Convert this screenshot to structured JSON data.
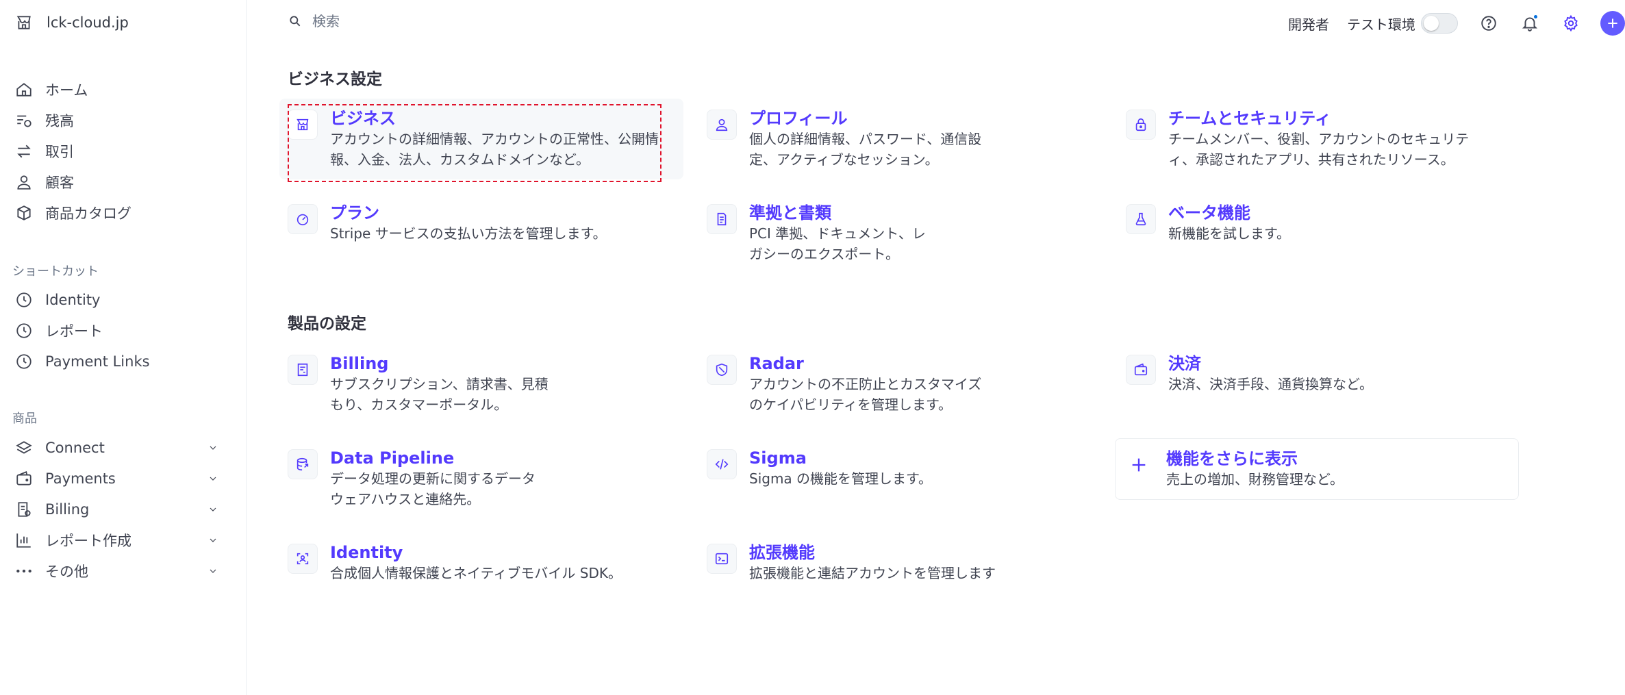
{
  "sidebar": {
    "brand": "lck-cloud.jp",
    "main_items": [
      {
        "label": "ホーム",
        "icon": "home-icon"
      },
      {
        "label": "残高",
        "icon": "balance-icon"
      },
      {
        "label": "取引",
        "icon": "transactions-icon"
      },
      {
        "label": "顧客",
        "icon": "customer-icon"
      },
      {
        "label": "商品カタログ",
        "icon": "box-icon"
      }
    ],
    "shortcuts_label": "ショートカット",
    "shortcuts": [
      {
        "label": "Identity",
        "icon": "clock-icon"
      },
      {
        "label": "レポート",
        "icon": "clock-icon"
      },
      {
        "label": "Payment Links",
        "icon": "clock-icon"
      }
    ],
    "products_label": "商品",
    "products": [
      {
        "label": "Connect",
        "icon": "layers-icon"
      },
      {
        "label": "Payments",
        "icon": "wallet-icon"
      },
      {
        "label": "Billing",
        "icon": "invoice-icon"
      },
      {
        "label": "レポート作成",
        "icon": "chart-icon"
      },
      {
        "label": "その他",
        "icon": "more-icon"
      }
    ]
  },
  "topbar": {
    "search_placeholder": "検索",
    "developer_label": "開発者",
    "test_mode_label": "テスト環境"
  },
  "business_settings": {
    "heading": "ビジネス設定",
    "cards": [
      {
        "title": "ビジネス",
        "desc": "アカウントの詳細情報、アカウントの正常性、公開情報、入金、法人、カスタムドメインなど。",
        "icon": "store-icon"
      },
      {
        "title": "プロフィール",
        "desc": "個人の詳細情報、パスワード、通信設定、アクティブなセッション。",
        "icon": "person-icon"
      },
      {
        "title": "チームとセキュリティ",
        "desc": "チームメンバー、役割、アカウントのセキュリティ、承認されたアプリ、共有されたリソース。",
        "icon": "lock-icon"
      },
      {
        "title": "プラン",
        "desc": "Stripe サービスの支払い方法を管理します。",
        "icon": "gauge-icon"
      },
      {
        "title": "準拠と書類",
        "desc": "PCI 準拠、ドキュメント、レガシーのエクスポート。",
        "icon": "document-icon"
      },
      {
        "title": "ベータ機能",
        "desc": "新機能を試します。",
        "icon": "flask-icon"
      }
    ]
  },
  "product_settings": {
    "heading": "製品の設定",
    "cards": [
      {
        "title": "Billing",
        "desc": "サブスクリプション、請求書、見積もり、カスタマーポータル。",
        "icon": "invoice-icon"
      },
      {
        "title": "Radar",
        "desc": "アカウントの不正防止とカスタマイズのケイパビリティを管理します。",
        "icon": "shield-icon"
      },
      {
        "title": "決済",
        "desc": "決済、決済手段、通貨換算など。",
        "icon": "wallet-icon"
      },
      {
        "title": "Data Pipeline",
        "desc": "データ処理の更新に関するデータウェアハウスと連絡先。",
        "icon": "database-icon"
      },
      {
        "title": "Sigma",
        "desc": "Sigma の機能を管理します。",
        "icon": "code-icon"
      },
      {
        "title": "機能をさらに表示",
        "desc": "売上の増加、財務管理など。",
        "icon": "plus-icon"
      },
      {
        "title": "Identity",
        "desc": "合成個人情報保護とネイティブモバイル SDK。",
        "icon": "face-scan-icon"
      },
      {
        "title": "拡張機能",
        "desc": "拡張機能と連結アカウントを管理します",
        "icon": "terminal-icon"
      }
    ]
  },
  "colors": {
    "accent": "#533afd",
    "primary_button": "#635bff",
    "notification_dot": "#0570de",
    "selection_outline": "#e0142c"
  }
}
